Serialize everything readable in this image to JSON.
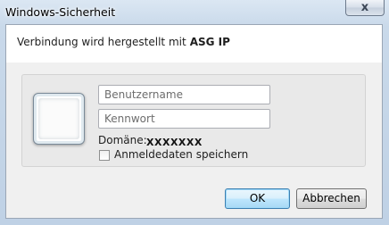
{
  "window": {
    "title": "Windows-Sicherheit",
    "close_glyph": "x"
  },
  "header": {
    "connecting_text": "Verbindung wird hergestellt mit",
    "host": "ASG IP"
  },
  "credentials": {
    "avatar_icon": "user-tile-icon",
    "username_placeholder": "Benutzername",
    "username_value": "",
    "password_placeholder": "Kennwort",
    "password_value": "",
    "domain_label": "Domäne:",
    "domain_value": "XXXXXXX",
    "remember_label": "Anmeldedaten speichern",
    "remember_checked": false
  },
  "buttons": {
    "ok": "OK",
    "cancel": "Abbrechen"
  }
}
